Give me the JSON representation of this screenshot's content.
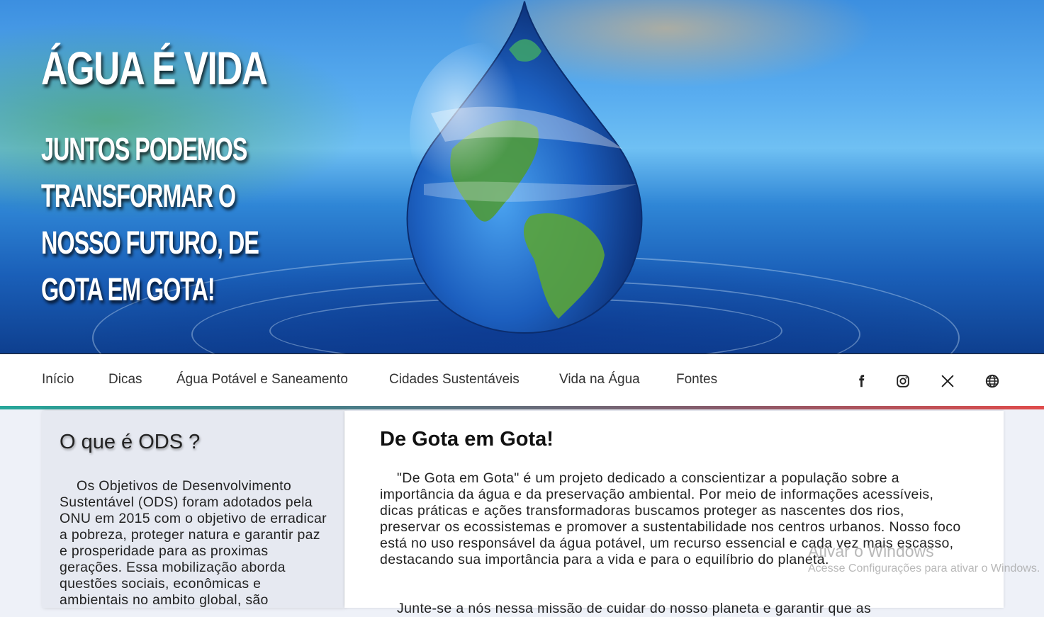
{
  "hero": {
    "title": "ÁGUA É VIDA",
    "subtitle": "Juntos podemos transformar o nosso futuro, de gota em gota!"
  },
  "nav": {
    "items": [
      "Início",
      "Dicas",
      "Água Potável e Saneamento",
      "Cidades Sustentáveis",
      "Vida na Água",
      "Fontes"
    ],
    "social": [
      "facebook-icon",
      "instagram-icon",
      "x-icon",
      "globe-icon"
    ]
  },
  "sidebar": {
    "title": "O que é ODS ?",
    "text": "Os Objetivos de Desenvolvimento Sustentável (ODS) foram adotados pela ONU em 2015 com o objetivo de erradicar a pobreza, proteger natura e garantir paz e prosperidade para as proximas gerações. Essa mobilização aborda questões sociais, econômicas e ambientais no ambito global, são"
  },
  "main": {
    "title": "De Gota em Gota!",
    "paragraph1": "\"De Gota em Gota\" é um projeto dedicado a conscientizar a população sobre a importância da água e da preservação ambiental. Por meio de informações acessíveis, dicas práticas e ações transformadoras buscamos proteger as nascentes dos rios, preservar os ecossistemas e promover a sustentabilidade nos centros urbanos. Nosso foco está no uso responsável da água potável, um recurso essencial e cada vez mais escasso, destacando sua importância para a vida e para o equilíbrio do planeta.",
    "paragraph2": "Junte-se a nós nessa missão de cuidar do nosso planeta e garantir que as"
  },
  "watermark": {
    "line1": "Ativar o Windows",
    "line2": "Acesse Configurações para ativar o Windows."
  }
}
